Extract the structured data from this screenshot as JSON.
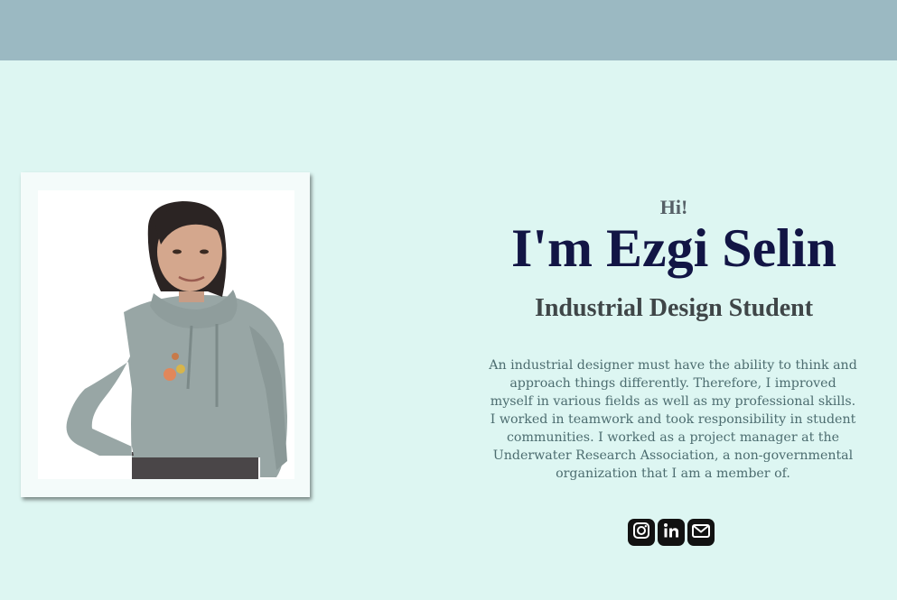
{
  "header": {
    "bar_color": "#9bb9c2"
  },
  "profile": {
    "photo_alt": "portrait-photo"
  },
  "intro": {
    "greeting": "Hi!",
    "name": "I'm Ezgi Selin",
    "role": "Industrial Design Student",
    "bio": "An industrial designer must have the ability to think and approach things differently. Therefore, I improved myself in various fields as well as my professional skills. I worked in teamwork and took responsibility in student communities. I worked as a project manager at the Underwater Research Association, a non-governmental organization that I am a member of."
  },
  "social_links": [
    {
      "icon": "instagram-icon"
    },
    {
      "icon": "linkedin-icon"
    },
    {
      "icon": "mail-icon"
    }
  ],
  "colors": {
    "background": "#ddf6f2",
    "name": "#121545",
    "role": "#3f4648",
    "bio": "#4d6d70"
  }
}
